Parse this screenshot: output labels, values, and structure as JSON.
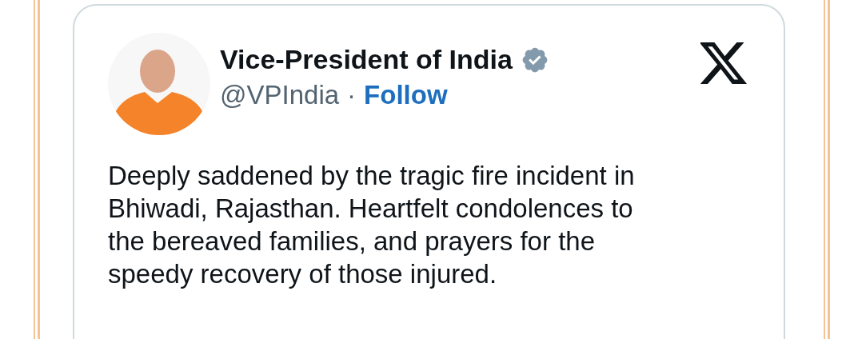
{
  "tweet": {
    "author_name": "Vice-President of India",
    "verified": true,
    "handle": "@VPIndia",
    "separator": "·",
    "follow_label": "Follow",
    "text": "Deeply saddened by the tragic fire incident in Bhiwadi, Rajasthan. Heartfelt condolences to the bereaved families, and prayers for the speedy recovery of those injured."
  }
}
